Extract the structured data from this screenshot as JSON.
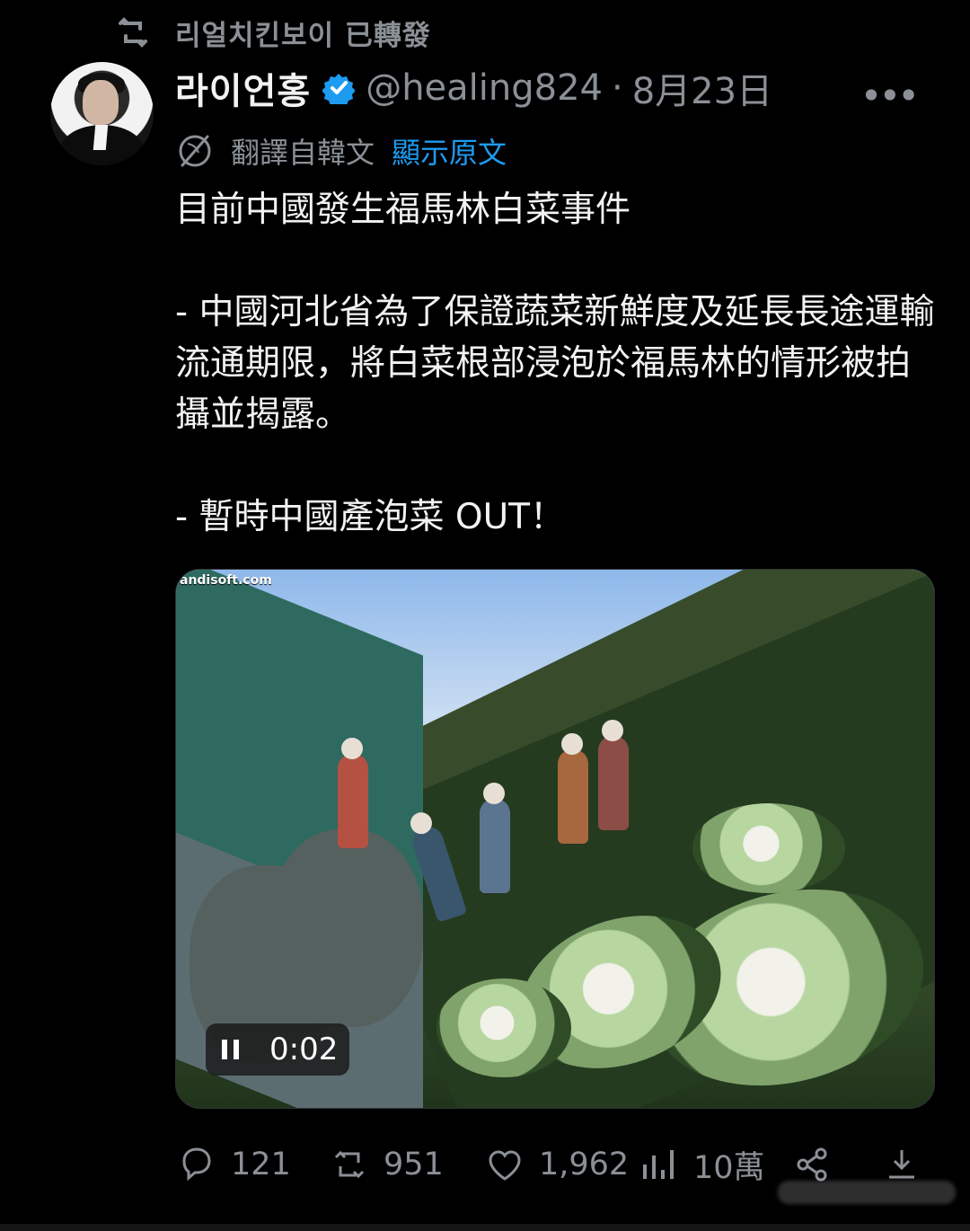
{
  "repost": {
    "icon": "retweet-icon",
    "text": "리얼치킨보이 已轉發"
  },
  "author": {
    "display_name": "라이언홍",
    "verified_icon": "verified-badge-icon",
    "handle": "@healing824",
    "separator": "·",
    "date": "8月23日"
  },
  "more_label": "•••",
  "translation": {
    "icon": "translate-icon",
    "label": "翻譯自韓文",
    "show_original": "顯示原文"
  },
  "tweet": {
    "text": "目前中國發生福馬林白菜事件\n\n- 中國河北省為了保證蔬菜新鮮度及延長長途運輸流通期限，將白菜根部浸泡於福馬林的情形被拍攝並揭露。\n\n- 暫時中國產泡菜 OUT！"
  },
  "media": {
    "watermark": "andisoft.com",
    "time": "0:02",
    "pause_icon": "pause-icon"
  },
  "actions": {
    "reply_count": "121",
    "retweet_count": "951",
    "like_count": "1,962",
    "views_count": "10萬"
  },
  "colors": {
    "background": "#000000",
    "text": "#e7e9ea",
    "muted": "#8b9096",
    "accent": "#1d9bf0"
  }
}
